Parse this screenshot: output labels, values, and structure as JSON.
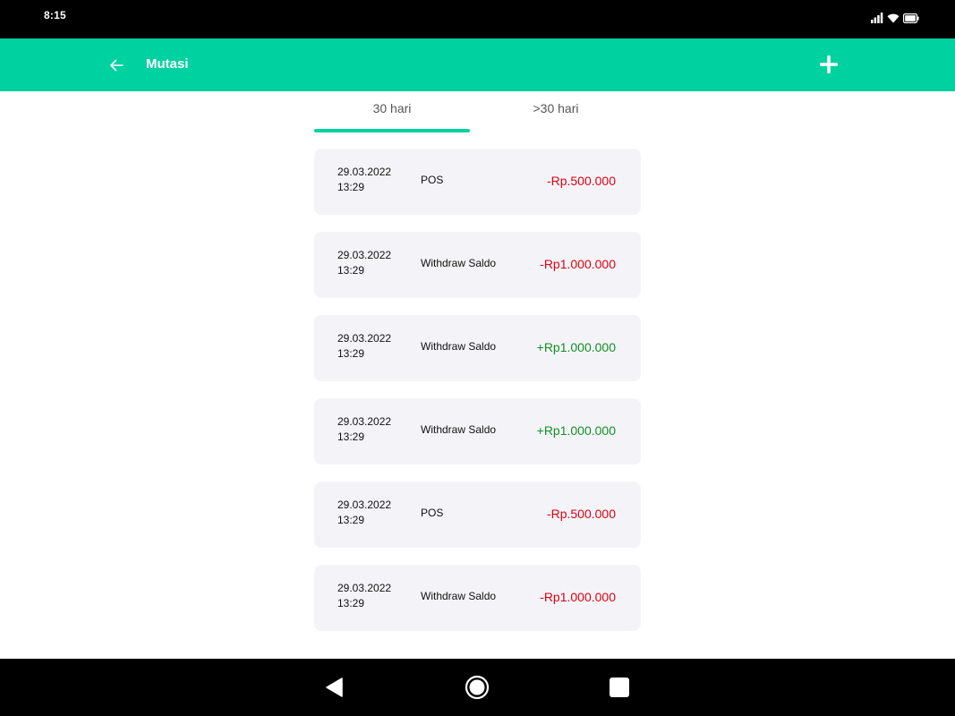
{
  "status_bar": {
    "time": "8:15",
    "icons": [
      "signal-icon",
      "wifi-icon",
      "battery-icon"
    ]
  },
  "app_bar": {
    "title": "Mutasi",
    "back_icon": "arrow-left-icon",
    "add_icon": "plus-icon"
  },
  "tabs": [
    {
      "label": "30 hari",
      "active": true
    },
    {
      "label": ">30 hari",
      "active": false
    }
  ],
  "transactions": [
    {
      "date": "29.03.2022",
      "time": "13:29",
      "description": "POS",
      "amount": "-Rp.500.000",
      "type": "negative"
    },
    {
      "date": "29.03.2022",
      "time": "13:29",
      "description": "Withdraw Saldo",
      "amount": "-Rp1.000.000",
      "type": "negative"
    },
    {
      "date": "29.03.2022",
      "time": "13:29",
      "description": "Withdraw Saldo",
      "amount": "+Rp1.000.000",
      "type": "positive"
    },
    {
      "date": "29.03.2022",
      "time": "13:29",
      "description": "Withdraw Saldo",
      "amount": "+Rp1.000.000",
      "type": "positive"
    },
    {
      "date": "29.03.2022",
      "time": "13:29",
      "description": "POS",
      "amount": "-Rp.500.000",
      "type": "negative"
    },
    {
      "date": "29.03.2022",
      "time": "13:29",
      "description": "Withdraw Saldo",
      "amount": "-Rp1.000.000",
      "type": "negative"
    }
  ],
  "nav_bar": {
    "icons": [
      "back-triangle-icon",
      "home-circle-icon",
      "recents-square-icon"
    ]
  },
  "colors": {
    "accent": "#00d1a0",
    "negative": "#e0000f",
    "positive": "#119022",
    "card_bg": "#f4f4f8"
  }
}
